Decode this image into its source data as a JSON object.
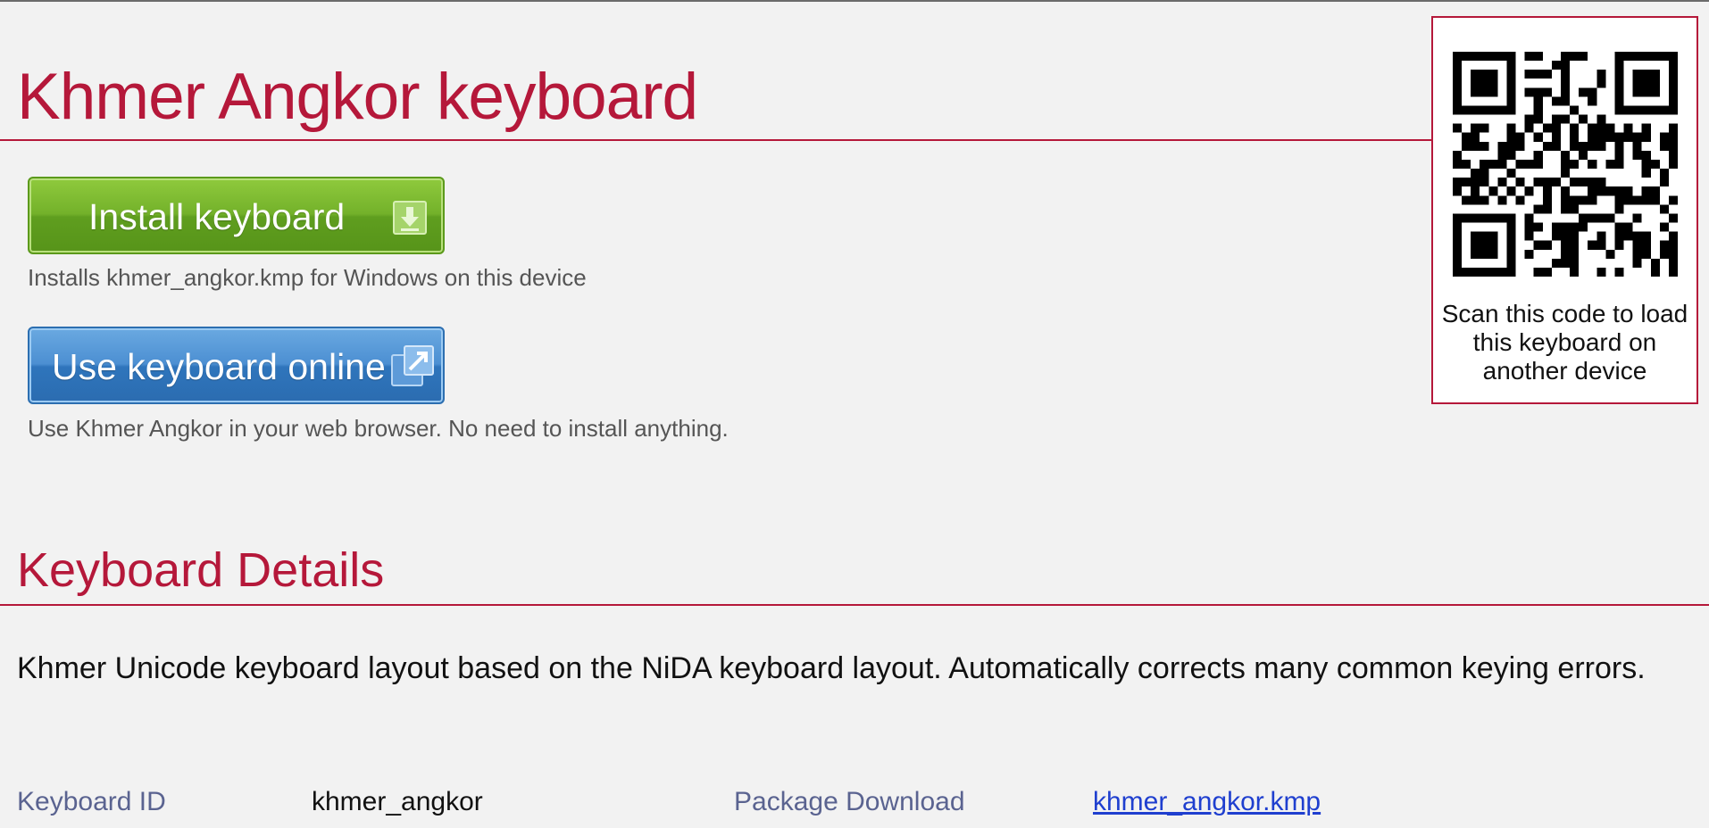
{
  "header": {
    "title": "Khmer Angkor keyboard"
  },
  "install": {
    "button_label": "Install keyboard",
    "icon": "download-icon",
    "description": "Installs khmer_angkor.kmp for Windows on this device"
  },
  "online": {
    "button_label": "Use keyboard online",
    "icon": "external-link-icon",
    "description": "Use Khmer Angkor in your web browser. No need to install anything."
  },
  "qr": {
    "icon": "qr-code-icon",
    "caption": "Scan this code to load this keyboard on another device"
  },
  "details": {
    "heading": "Keyboard Details",
    "description": "Khmer Unicode keyboard layout based on the NiDA keyboard layout. Automatically corrects many common keying errors.",
    "keyboard_id_label": "Keyboard ID",
    "keyboard_id_value": "khmer_angkor",
    "package_download_label": "Package Download",
    "package_download_link": "khmer_angkor.kmp"
  },
  "colors": {
    "accent": "#b5183a",
    "install_green": "#73b12a",
    "online_blue": "#2f75bc",
    "link": "#1f3fcf",
    "label": "#5a6390"
  }
}
